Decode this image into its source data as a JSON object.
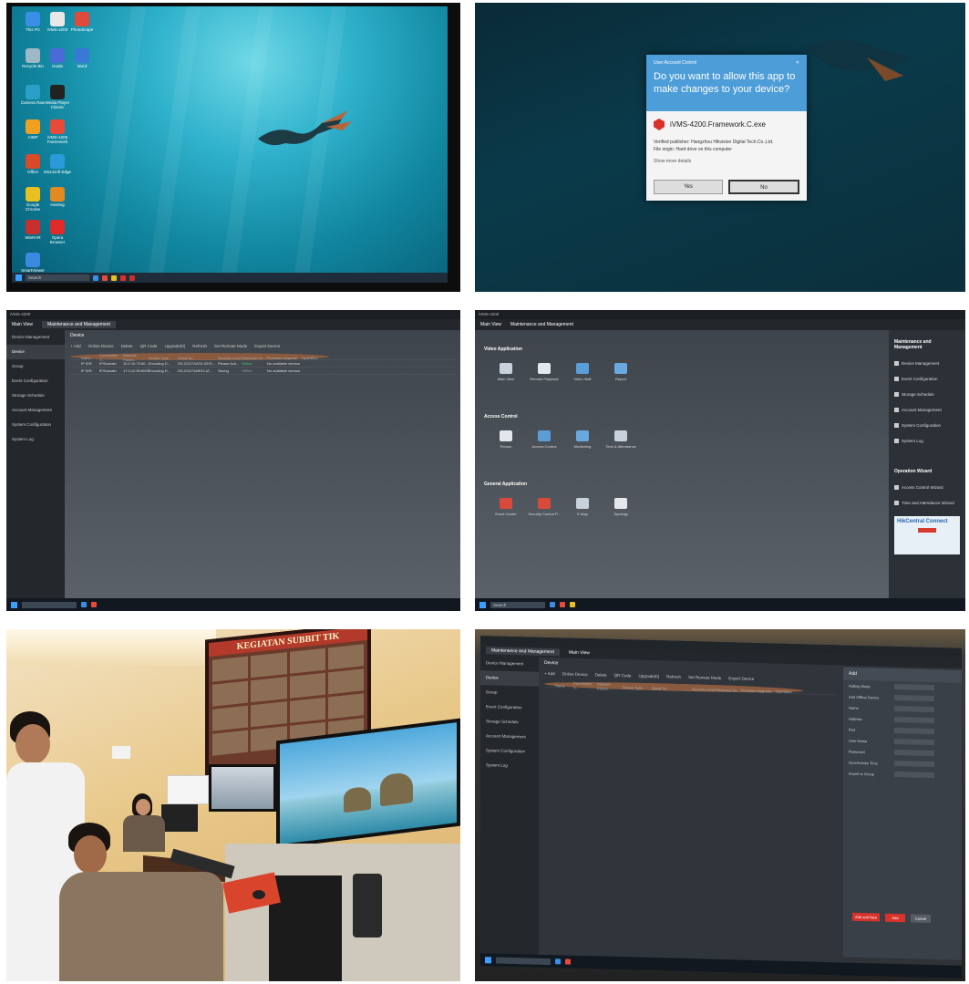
{
  "desktop": {
    "icons": [
      {
        "label": "This PC",
        "color": "#3a8ee6"
      },
      {
        "label": "iVMS-4200",
        "color": "#e8e8e8"
      },
      {
        "label": "PhotoScape",
        "color": "#e04a3a"
      },
      {
        "label": "Recycle Bin",
        "color": "#9fb8c8"
      },
      {
        "label": "Guide",
        "color": "#4a6ad8"
      },
      {
        "label": "Word",
        "color": "#3a78d8"
      },
      {
        "label": "Camera Raw",
        "color": "#2aa0c8"
      },
      {
        "label": "Media Player Classic",
        "color": "#222222"
      },
      {
        "label": "AIMP",
        "color": "#f0a020"
      },
      {
        "label": "iVMS-4200 Framework",
        "color": "#e84a3a"
      },
      {
        "label": "Office",
        "color": "#d84a2a"
      },
      {
        "label": "Microsoft Edge",
        "color": "#2a9ad8"
      },
      {
        "label": "Google Chrome",
        "color": "#e8c020"
      },
      {
        "label": "Hosting",
        "color": "#e08a20"
      },
      {
        "label": "WinRAR",
        "color": "#c83030"
      },
      {
        "label": "Opera Browser",
        "color": "#e02a2a"
      },
      {
        "label": "SmartViewer",
        "color": "#3a8ae0"
      }
    ],
    "search_placeholder": "Search"
  },
  "uac": {
    "window_title": "User Account Control",
    "question": "Do you want to allow this app to make changes to your device?",
    "app_name": "iVMS-4200.Framework.C.exe",
    "publisher": "Verified publisher: Hangzhou Hikvision Digital Tech.Co.,Ltd.",
    "origin": "File origin: Hard drive on this computer",
    "more": "Show more details",
    "yes_label": "Yes",
    "no_label": "No"
  },
  "device_view": {
    "app_title": "iVMS-4200",
    "tabs": [
      "Main View",
      "Maintenance and Management"
    ],
    "sidebar": [
      "Device Management",
      "Device",
      "Group",
      "Event Configuration",
      "Storage Schedule",
      "Account Management",
      "System Configuration",
      "System Log"
    ],
    "section": "Device",
    "toolbar": [
      "+ Add",
      "Online Device",
      "Delete",
      "QR Code",
      "Upgrade(0)",
      "Refresh",
      "Set Remote Mode",
      "Export Device"
    ],
    "columns": [
      "",
      "Name",
      "Connection T...",
      "Network Param...",
      "Device Type",
      "Serial No.",
      "Security Level",
      "Resource Us...",
      "Firmware Upgrade",
      "Operation"
    ],
    "rows": [
      [
        "",
        "ER_PENAL...",
        "IP/Domain",
        "10.10.10.71:8000",
        "Encoding D...",
        "DS-7616NI-K2...",
        "Strong",
        "Online",
        "No available version",
        ""
      ],
      [
        "",
        "IP IDR",
        "IP/Domain",
        "10.0.10.72:80...",
        "Encoding D...",
        "DS-2CD7A2G0-IZHS...",
        "Please Acti...",
        "Online",
        "No available version",
        ""
      ],
      [
        "",
        "IP IDR",
        "IP/Domain",
        "17.0.10.50:8000",
        "Encoding D...",
        "DS-2CD7A26G0-IZ...",
        "Strong",
        "Offline",
        "No available version",
        ""
      ]
    ]
  },
  "main_view": {
    "tabs": [
      "Main View",
      "Maintenance and Management"
    ],
    "sections": [
      {
        "title": "Video Application",
        "items": [
          "Main View",
          "Remote Playback",
          "Video Wall",
          "Report"
        ]
      },
      {
        "title": "Access Control",
        "items": [
          "Person",
          "Access Control",
          "Monitoring",
          "Time & Attendance"
        ]
      },
      {
        "title": "General Application",
        "items": [
          "Event Center",
          "Security Control P...",
          "E-Map",
          "Topology"
        ]
      }
    ],
    "right_title": "Maintenance and Management",
    "right_items": [
      "Device Management",
      "Event Configuration",
      "Storage Schedule",
      "Account Management",
      "System Configuration",
      "System Log"
    ],
    "wizard_title": "Operation Wizard",
    "wizard_items": [
      "Access Control Wizard",
      "Time and Attendance Wizard"
    ],
    "promo_title": "HikCentral Connect",
    "promo_button": "Learn More"
  },
  "photo": {
    "poster_title": "KEGIATAN SUBBIT TIK"
  },
  "add_form": {
    "title": "Add",
    "fields": [
      "Adding Mode",
      "Add Offline Device",
      "Name",
      "Address",
      "Port",
      "User Name",
      "Password",
      "Synchronize Time",
      "Import to Group"
    ],
    "add_button": "Add and New",
    "ok_button": "Add",
    "cancel_button": "Cancel"
  }
}
